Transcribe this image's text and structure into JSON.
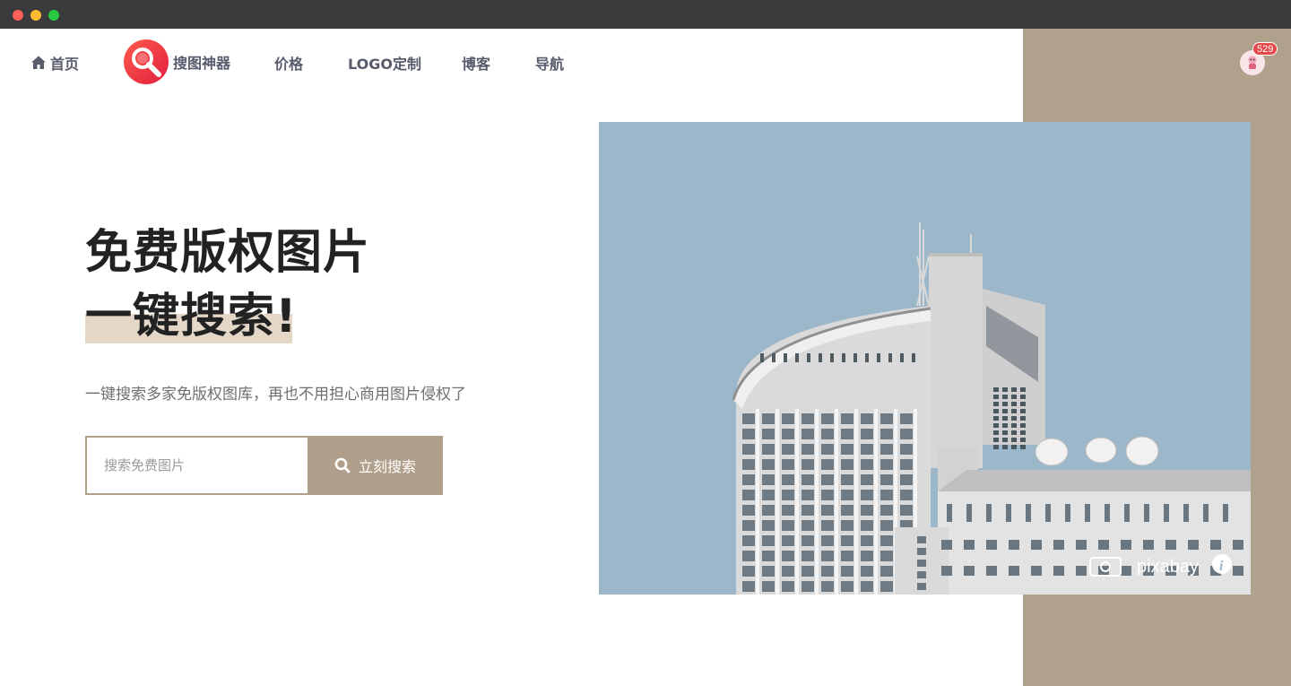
{
  "colors": {
    "accent": "#b0a08b",
    "panel": "#b0a18c",
    "highlight": "#e4d7c8",
    "sky": "#9cb6ca",
    "brand_red": "#e8273b",
    "badge": "#e54848"
  },
  "nav": {
    "home_label": "首页",
    "brand_label": "搜图神器",
    "price_label": "价格",
    "logo_label": "LOGO定制",
    "blog_label": "博客",
    "guide_label": "导航"
  },
  "user": {
    "badge_count": "529"
  },
  "hero": {
    "title_line1": "免费版权图片",
    "title_line2": "一键搜索!",
    "subtitle": "一键搜索多家免版权图库，再也不用担心商用图片侵权了"
  },
  "search": {
    "placeholder": "搜索免费图片",
    "value": "",
    "button_label": "立刻搜索"
  },
  "photo": {
    "watermark": "pixabay"
  }
}
